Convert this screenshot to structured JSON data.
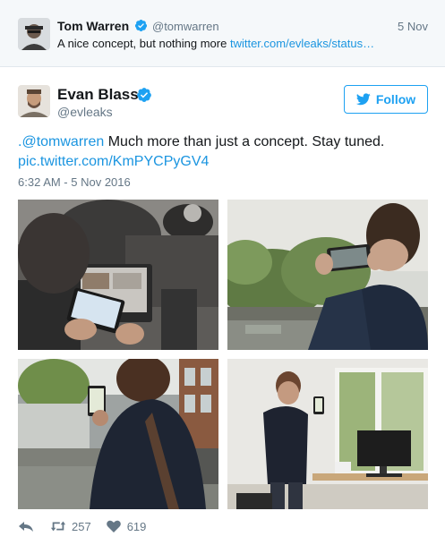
{
  "parent_tweet": {
    "name": "Tom Warren",
    "handle": "@tomwarren",
    "date": "5 Nov",
    "text_plain": "A nice concept, but nothing more ",
    "text_link": "twitter.com/evleaks/status…"
  },
  "main_tweet": {
    "name": "Evan Blass",
    "handle": "@evleaks",
    "follow_label": "Follow",
    "mention": ".@tomwarren",
    "body": " Much more than just a concept. Stay tuned.",
    "pic_link": "pic.twitter.com/KmPYCPyGV4",
    "timestamp": "6:32 AM - 5 Nov 2016"
  },
  "actions": {
    "retweets": "257",
    "likes": "619"
  },
  "colors": {
    "accent": "#1da1f2",
    "link": "#1b95e0",
    "muted": "#657786",
    "parent_bg": "#f5f8fa"
  },
  "icons": [
    "verified-icon",
    "twitter-bird-icon",
    "reply-icon",
    "retweet-icon",
    "heart-icon"
  ]
}
